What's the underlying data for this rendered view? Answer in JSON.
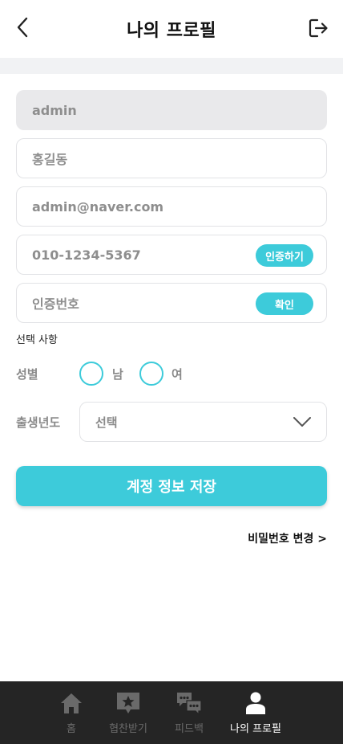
{
  "header": {
    "title": "나의 프로필",
    "back_icon": "chevron-left-icon",
    "logout_icon": "logout-icon"
  },
  "form": {
    "user_id": "admin",
    "name": "홍길동",
    "email": "admin@naver.com",
    "phone": "010-1234-5367",
    "verify_phone_label": "인증하기",
    "verify_code_placeholder": "인증번호",
    "confirm_label": "확인",
    "optional_section_label": "선택 사항",
    "gender_label": "성별",
    "gender_options": [
      "남",
      "여"
    ],
    "birth_year_label": "출생년도",
    "birth_year_value": "선택",
    "save_label": "계정 정보 저장",
    "change_password_label": "비밀번호 변경 >"
  },
  "bottom_nav": {
    "items": [
      {
        "label": "홈",
        "icon": "home-icon",
        "active": false
      },
      {
        "label": "협찬받기",
        "icon": "star-icon",
        "active": false
      },
      {
        "label": "피드백",
        "icon": "chat-icon",
        "active": false
      },
      {
        "label": "나의 프로필",
        "icon": "person-icon",
        "active": true
      }
    ]
  },
  "colors": {
    "accent": "#3dcbda",
    "nav_bg": "#252525",
    "field_border": "#e2e3e6",
    "disabled_bg": "#e9e9eb"
  }
}
